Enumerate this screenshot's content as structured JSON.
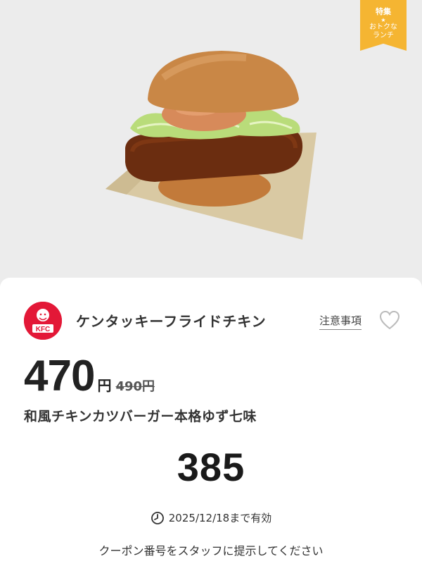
{
  "ribbon": {
    "line1": "特集",
    "star": "★",
    "line2a": "おトクな",
    "line2b": "ランチ"
  },
  "logo": {
    "text": "KFC"
  },
  "shop": {
    "name": "ケンタッキーフライドチキン",
    "notes_label": "注意事項"
  },
  "price": {
    "current": "470",
    "currency": "円",
    "original": "490円"
  },
  "product": {
    "name": "和風チキンカツバーガー本格ゆず七味"
  },
  "coupon": {
    "code": "385",
    "validity": "2025/12/18まで有効",
    "instruction": "クーポン番号をスタッフに提示してください"
  },
  "colors": {
    "kfc_red": "#e31837",
    "ribbon": "#f5b532"
  }
}
